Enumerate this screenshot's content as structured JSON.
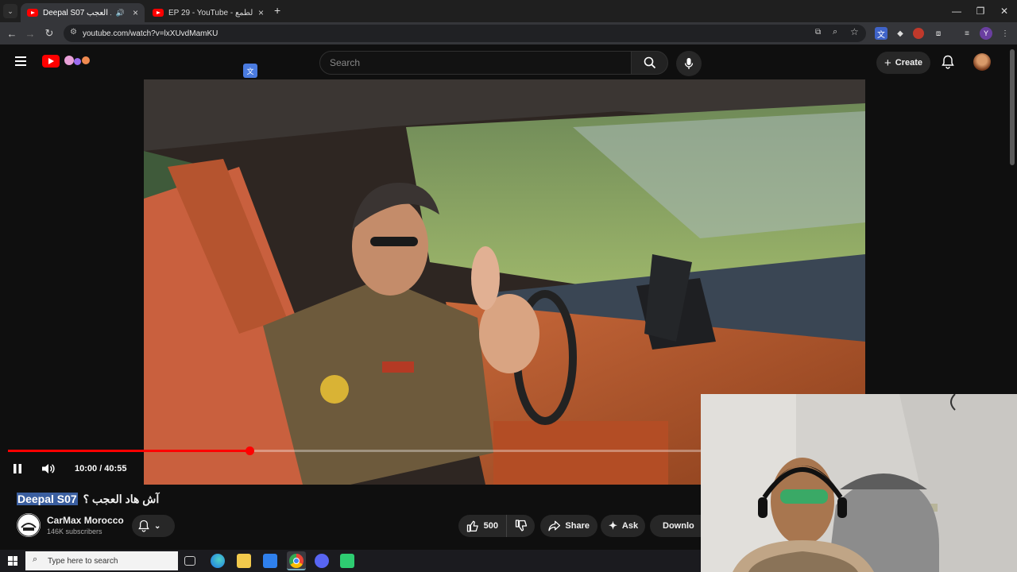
{
  "browser": {
    "tabs": [
      {
        "title": "Deepal S07 ؟ آش هاد العجب",
        "active": true
      },
      {
        "title": "EP 29 - YouTube - عش الطمع",
        "active": false
      }
    ],
    "new_tab": "+",
    "url": "youtube.com/watch?v=lxXUvdMamKU",
    "profile_letter": "Y"
  },
  "youtube": {
    "search_placeholder": "Search",
    "create_label": "Create"
  },
  "player": {
    "current_time": "10:00",
    "duration": "40:55",
    "time_display": "10:00 / 40:55",
    "progress_fraction": 0.3487
  },
  "video": {
    "title_highlight": "Deepal S07",
    "title_rest": "آش هاد العجب ؟",
    "channel_name": "CarMax Morocco",
    "subscribers": "146K subscribers",
    "like_count": "500",
    "share_label": "Share",
    "ask_label": "Ask",
    "download_label": "Downlo"
  },
  "taskbar": {
    "search_placeholder": "Type here to search"
  },
  "colors": {
    "accent": "#ff0000",
    "background": "#0f0f0f",
    "selection": "#3b5fa0"
  }
}
